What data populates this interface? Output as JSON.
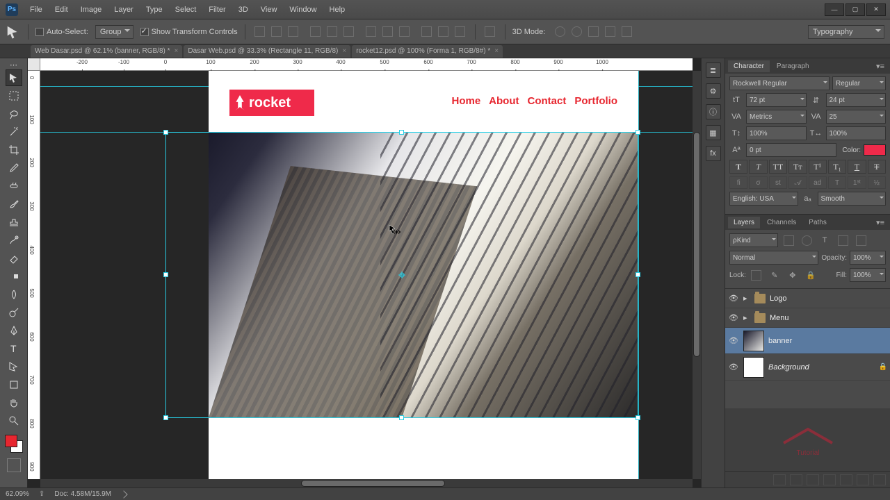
{
  "menu": [
    "File",
    "Edit",
    "Image",
    "Layer",
    "Type",
    "Select",
    "Filter",
    "3D",
    "View",
    "Window",
    "Help"
  ],
  "options": {
    "auto_select": "Auto-Select:",
    "group": "Group",
    "show_transform": "Show Transform Controls",
    "mode_label": "3D Mode:",
    "workspace": "Typography"
  },
  "doc_tabs": [
    "Web Dasar.psd @ 62.1% (banner, RGB/8) *",
    "Dasar Web.psd @ 33.3% (Rectangle 11, RGB/8)",
    "rocket12.psd @ 100% (Forma 1, RGB/8#) *"
  ],
  "ruler_h": [
    {
      "pos": 60,
      "label": "-200"
    },
    {
      "pos": 120,
      "label": "-100"
    },
    {
      "pos": 180,
      "label": "0"
    },
    {
      "pos": 245,
      "label": "100"
    },
    {
      "pos": 308,
      "label": "200"
    },
    {
      "pos": 370,
      "label": "300"
    },
    {
      "pos": 432,
      "label": "400"
    },
    {
      "pos": 495,
      "label": "500"
    },
    {
      "pos": 558,
      "label": "600"
    },
    {
      "pos": 620,
      "label": "700"
    },
    {
      "pos": 683,
      "label": "800"
    },
    {
      "pos": 745,
      "label": "900"
    },
    {
      "pos": 808,
      "label": "1000"
    }
  ],
  "ruler_v": [
    {
      "pos": 10,
      "label": "0"
    },
    {
      "pos": 70,
      "label": "100"
    },
    {
      "pos": 132,
      "label": "200"
    },
    {
      "pos": 195,
      "label": "300"
    },
    {
      "pos": 258,
      "label": "400"
    },
    {
      "pos": 320,
      "label": "500"
    },
    {
      "pos": 383,
      "label": "600"
    },
    {
      "pos": 445,
      "label": "700"
    },
    {
      "pos": 508,
      "label": "800"
    },
    {
      "pos": 570,
      "label": "900"
    }
  ],
  "page_content": {
    "logo_text": "rocket",
    "nav": [
      "Home",
      "About",
      "Contact",
      "Portfolio"
    ]
  },
  "character": {
    "font": "Rockwell Regular",
    "style": "Regular",
    "size": "72 pt",
    "leading": "24 pt",
    "kerning": "Metrics",
    "tracking": "25",
    "vscale": "100%",
    "hscale": "100%",
    "baseline": "0 pt",
    "color_label": "Color:",
    "color": "#ef2a4a",
    "lang": "English: USA",
    "aa": "Smooth",
    "tabs": {
      "character": "Character",
      "paragraph": "Paragraph"
    }
  },
  "layers_panel": {
    "tabs": {
      "layers": "Layers",
      "channels": "Channels",
      "paths": "Paths"
    },
    "kind": "Kind",
    "blend": "Normal",
    "opacity_label": "Opacity:",
    "opacity": "100%",
    "lock_label": "Lock:",
    "fill_label": "Fill:",
    "fill": "100%",
    "layers": [
      {
        "name": "Logo",
        "type": "folder"
      },
      {
        "name": "Menu",
        "type": "folder"
      },
      {
        "name": "banner",
        "type": "image",
        "selected": true
      },
      {
        "name": "Background",
        "type": "bg",
        "locked": true
      }
    ]
  },
  "status": {
    "zoom": "62.09%",
    "doc": "Doc: 4.58M/15.9M"
  }
}
